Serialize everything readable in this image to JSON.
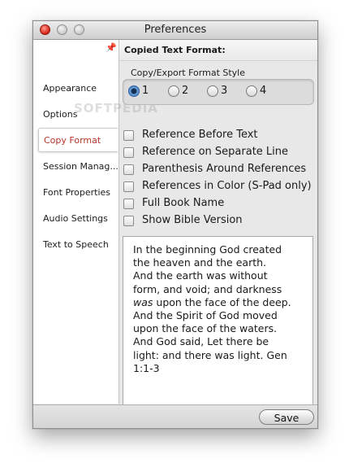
{
  "window": {
    "title": "Preferences"
  },
  "sidebar": {
    "items": [
      {
        "label": "Appearance"
      },
      {
        "label": "Options"
      },
      {
        "label": "Copy Format"
      },
      {
        "label": "Session Manag..."
      },
      {
        "label": "Font Properties"
      },
      {
        "label": "Audio Settings"
      },
      {
        "label": "Text to Speech"
      }
    ],
    "selected_index": 2
  },
  "copy_format": {
    "section_title": "Copied Text Format:",
    "style_group_label": "Copy/Export Format Style",
    "style_options": [
      {
        "label": "1",
        "selected": true
      },
      {
        "label": "2",
        "selected": false
      },
      {
        "label": "3",
        "selected": false
      },
      {
        "label": "4",
        "selected": false
      }
    ],
    "options": [
      {
        "label": "Reference Before Text",
        "checked": false
      },
      {
        "label": "Reference on Separate Line",
        "checked": false
      },
      {
        "label": "Parenthesis Around References",
        "checked": false
      },
      {
        "label": "References in Color (S-Pad only)",
        "checked": false
      },
      {
        "label": "Full Book Name",
        "checked": false
      },
      {
        "label": "Show Bible Version",
        "checked": false
      }
    ],
    "preview": {
      "lines": [
        "In the beginning God created",
        "the heaven and the earth.",
        "And the earth was without",
        "form, and void; and darkness",
        "upon the face of the deep.",
        "And the Spirit of God moved",
        "upon the face of the waters.",
        "And God said, Let there be",
        "light: and there was light. Gen",
        "1:1-3"
      ],
      "italic_word": "was"
    }
  },
  "footer": {
    "save_label": "Save"
  },
  "watermark": "SOFTPEDIA",
  "colors": {
    "selected_nav_text": "#b3362a",
    "radio_selected": "#3b77c0",
    "close_button": "#d9281c"
  }
}
